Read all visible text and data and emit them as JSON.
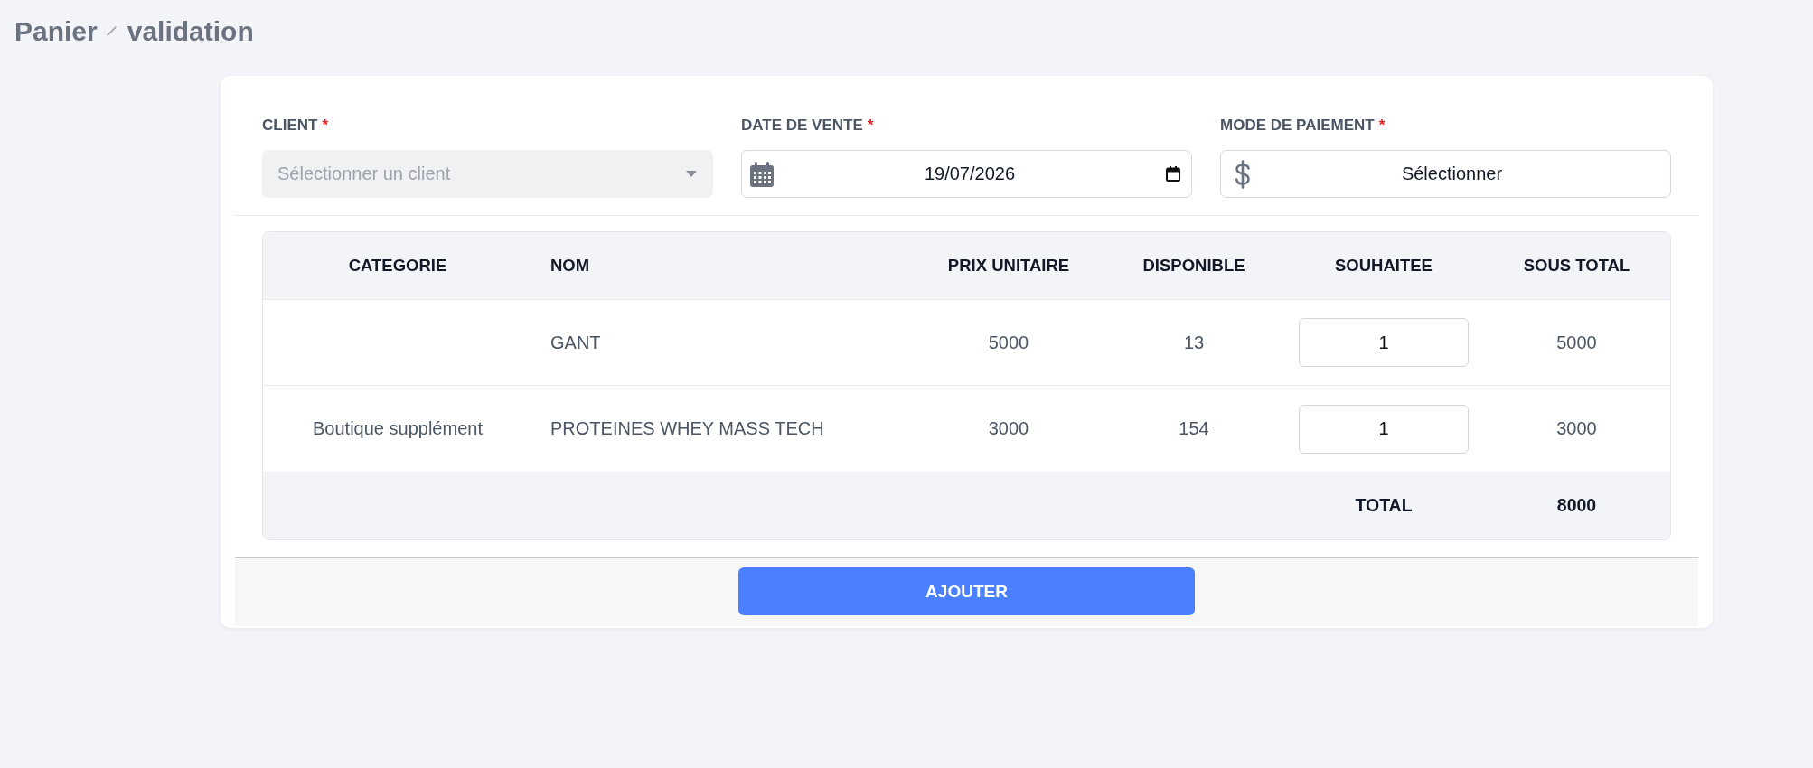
{
  "header": {
    "breadcrumb": [
      {
        "label": "Panier"
      },
      {
        "label": "validation"
      }
    ]
  },
  "form": {
    "fields": [
      {
        "kind": "select",
        "label": "CLIENT",
        "required_mark": "*",
        "placeholder": "Sélectionner un client",
        "disabled": true
      },
      {
        "kind": "date",
        "label": "DATE DE VENTE",
        "required_mark": "*",
        "value": "19/07/2026"
      },
      {
        "kind": "currency",
        "label": "MODE DE PAIEMENT",
        "required_mark": "*",
        "value": "Sélectionner"
      }
    ]
  },
  "table": {
    "columns": [
      "CATEGORIE",
      "NOM",
      "PRIX UNITAIRE",
      "DISPONIBLE",
      "SOUHAITEE",
      "SOUS TOTAL"
    ],
    "rows": [
      {
        "name": "GANT",
        "unit_price": "5000",
        "available": "13",
        "quantity": "1",
        "subtotal": "5000"
      },
      {
        "category": "Boutique supplément",
        "name": "PROTEINES WHEY MASS TECH",
        "unit_price": "3000",
        "available": "154",
        "quantity": "1",
        "subtotal": "3000"
      }
    ],
    "total": {
      "label": "TOTAL",
      "value": "8000"
    }
  },
  "footer": {
    "button": "AJOUTER"
  }
}
